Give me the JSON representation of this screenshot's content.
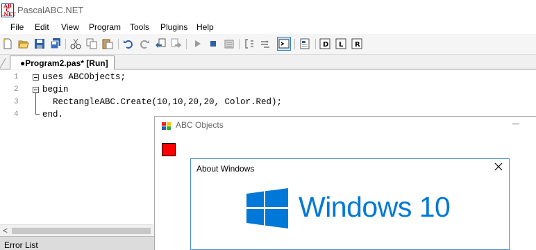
{
  "app": {
    "title": "PascalABC.NET",
    "icon_letters": [
      "AB",
      "C",
      ".NET"
    ]
  },
  "menu": [
    "File",
    "Edit",
    "View",
    "Program",
    "Tools",
    "Plugins",
    "Help"
  ],
  "toolbar": {
    "icons": [
      "new-file-icon",
      "open-icon",
      "save-icon",
      "save-all-icon",
      "cut-icon",
      "copy-icon",
      "paste-icon",
      "undo-icon",
      "redo-icon",
      "navigate-back-icon",
      "navigate-forward-icon",
      "run-icon",
      "stop-icon",
      "compile-icon",
      "format-icon",
      "debug-step-icon",
      "console-icon",
      "output-window-icon",
      "designer-icon",
      "library-icon",
      "reference-icon"
    ]
  },
  "editor": {
    "tab_label": "●Program2.pas* [Run]",
    "lines": [
      {
        "num": "1",
        "text": "uses ABCObjects;"
      },
      {
        "num": "2",
        "text": "begin"
      },
      {
        "num": "3",
        "text": "  RectangleABC.Create(10,10,20,20, Color.Red);"
      },
      {
        "num": "4",
        "text": "end."
      }
    ]
  },
  "error_panel": {
    "tab_label": "Error List"
  },
  "abc_window": {
    "title": "ABC Objects",
    "rect_color": "#ff0000"
  },
  "about_dialog": {
    "title": "About Windows",
    "logo_text": "Windows 10",
    "logo_color": "#0078d7"
  }
}
